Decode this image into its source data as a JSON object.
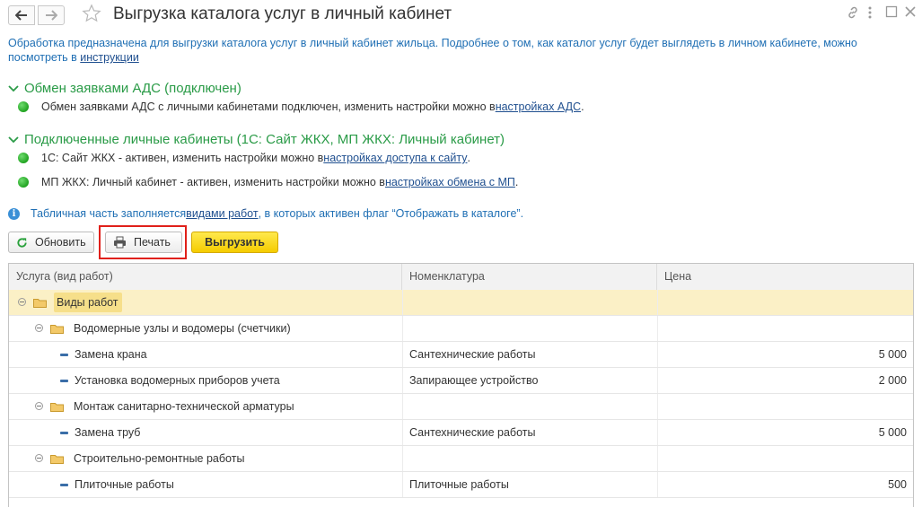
{
  "window": {
    "title": "Выгрузка каталога услуг в личный кабинет"
  },
  "description": {
    "text": "Обработка предназначена для выгрузки каталога услуг в личный кабинет жильца. Подробнее о том, как каталог услуг будет выглядеть в личном кабинете, можно посмотреть в ",
    "link": "инструкции"
  },
  "ads_group": {
    "title": "Обмен заявками АДС (подключен)",
    "rows": [
      {
        "text": "Обмен заявками АДС с личными кабинетами подключен, изменить настройки можно в ",
        "link": "настройках АДС",
        "tail": "."
      }
    ]
  },
  "cabinets_group": {
    "title": "Подключенные личные кабинеты (1С: Сайт ЖКХ, МП ЖКХ: Личный кабинет)",
    "rows": [
      {
        "text": "1С: Сайт ЖКХ - активен, изменить настройки можно в ",
        "link": "настройках доступа к сайту",
        "tail": "."
      },
      {
        "text": "МП ЖКХ: Личный кабинет - активен, изменить настройки можно в ",
        "link": "настройках обмена с МП",
        "tail": "."
      }
    ]
  },
  "info": {
    "text": "Табличная часть заполняется ",
    "link": "видами работ",
    "tail": ", в которых активен флаг “Отображать в каталоге”."
  },
  "toolbar": {
    "refresh_label": "Обновить",
    "print_label": "Печать",
    "export_label": "Выгрузить"
  },
  "table": {
    "columns": [
      "Услуга (вид работ)",
      "Номенклатура",
      "Цена"
    ],
    "rows": [
      {
        "level": 0,
        "kind": "folder",
        "name": "Виды работ",
        "nomenclature": "",
        "price": "",
        "selected": true
      },
      {
        "level": 1,
        "kind": "folder",
        "name": "Водомерные узлы и водомеры (счетчики)",
        "nomenclature": "",
        "price": ""
      },
      {
        "level": 2,
        "kind": "item",
        "name": "Замена крана",
        "nomenclature": "Сантехнические работы",
        "price": "5 000"
      },
      {
        "level": 2,
        "kind": "item",
        "name": "Установка водомерных приборов учета",
        "nomenclature": "Запирающее устройство",
        "price": "2 000"
      },
      {
        "level": 1,
        "kind": "folder",
        "name": "Монтаж санитарно-технической арматуры",
        "nomenclature": "",
        "price": ""
      },
      {
        "level": 2,
        "kind": "item",
        "name": "Замена труб",
        "nomenclature": "Сантехнические работы",
        "price": "5 000"
      },
      {
        "level": 1,
        "kind": "folder",
        "name": "Строительно-ремонтные работы",
        "nomenclature": "",
        "price": ""
      },
      {
        "level": 2,
        "kind": "item",
        "name": "Плиточные работы",
        "nomenclature": "Плиточные работы",
        "price": "500"
      }
    ]
  },
  "colors": {
    "accent_green": "#2a9b47",
    "link_blue": "#1f6fb4",
    "highlight_red": "#e0201a",
    "export_yellow": "#f5cc00",
    "selected_row": "#fbf0c6"
  },
  "icons": {
    "back": "arrow-left-icon",
    "forward": "arrow-right-icon",
    "favorite": "star-icon",
    "link": "link-icon",
    "more": "more-icon",
    "maximize": "maximize-icon",
    "close": "close-icon",
    "refresh": "refresh-icon",
    "print": "printer-icon",
    "info": "info-icon",
    "status": "green-status-dot-icon"
  }
}
